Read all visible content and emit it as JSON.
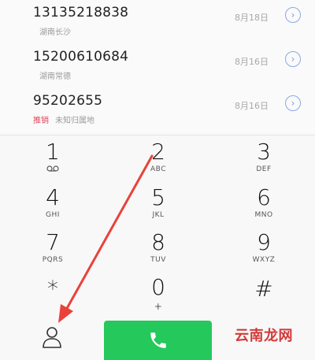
{
  "call_log": [
    {
      "number": "13135218838",
      "sub_tag": "",
      "sub_location": "湖南长沙",
      "date": "8月18日"
    },
    {
      "number": "15200610684",
      "sub_tag": "",
      "sub_location": "湖南常德",
      "date": "8月16日"
    },
    {
      "number": "95202655",
      "sub_tag": "推销",
      "sub_location": "未知归属地",
      "date": "8月16日"
    }
  ],
  "keypad": [
    {
      "digit": "1",
      "letters": "ꝏ"
    },
    {
      "digit": "2",
      "letters": "ABC"
    },
    {
      "digit": "3",
      "letters": "DEF"
    },
    {
      "digit": "4",
      "letters": "GHI"
    },
    {
      "digit": "5",
      "letters": "JKL"
    },
    {
      "digit": "6",
      "letters": "MNO"
    },
    {
      "digit": "7",
      "letters": "PQRS"
    },
    {
      "digit": "8",
      "letters": "TUV"
    },
    {
      "digit": "9",
      "letters": "WXYZ"
    },
    {
      "digit": "*",
      "letters": ""
    },
    {
      "digit": "0",
      "letters": "+"
    },
    {
      "digit": "#",
      "letters": ""
    }
  ],
  "icons": {
    "info": "info-chevron-icon",
    "contacts": "person-icon",
    "call": "phone-handset-icon"
  },
  "colors": {
    "call_button": "#25c85b",
    "tag_red": "#e2445c",
    "annotation_arrow": "#e8423a",
    "watermark": "#d23a3a"
  },
  "watermark": "云南龙网"
}
